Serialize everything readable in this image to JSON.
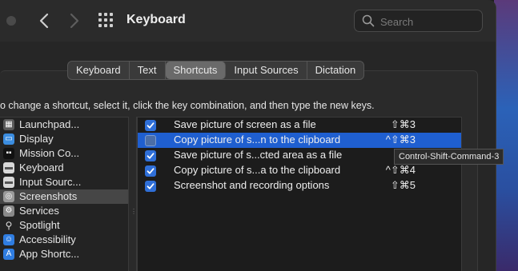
{
  "window": {
    "title": "Keyboard",
    "search": {
      "placeholder": "Search",
      "value": ""
    }
  },
  "tabs": [
    {
      "label": "Keyboard",
      "active": false
    },
    {
      "label": "Text",
      "active": false
    },
    {
      "label": "Shortcuts",
      "active": true
    },
    {
      "label": "Input Sources",
      "active": false
    },
    {
      "label": "Dictation",
      "active": false
    }
  ],
  "instruction": "o change a shortcut, select it, click the key combination, and then type the new keys.",
  "sidebar": {
    "items": [
      {
        "label": "Launchpad...",
        "icon": "launchpad-icon",
        "selected": false
      },
      {
        "label": "Display",
        "icon": "display-icon",
        "selected": false
      },
      {
        "label": "Mission Co...",
        "icon": "mission-control-icon",
        "selected": false
      },
      {
        "label": "Keyboard",
        "icon": "keyboard-icon",
        "selected": false
      },
      {
        "label": "Input Sourc...",
        "icon": "input-sources-icon",
        "selected": false
      },
      {
        "label": "Screenshots",
        "icon": "screenshot-icon",
        "selected": true
      },
      {
        "label": "Services",
        "icon": "gear-icon",
        "selected": false
      },
      {
        "label": "Spotlight",
        "icon": "spotlight-icon",
        "selected": false
      },
      {
        "label": "Accessibility",
        "icon": "accessibility-icon",
        "selected": false
      },
      {
        "label": "App Shortc...",
        "icon": "app-shortcuts-icon",
        "selected": false
      }
    ]
  },
  "shortcuts": [
    {
      "label": "Save picture of screen as a file",
      "keys": "⇧⌘3",
      "checked": true,
      "selected": false
    },
    {
      "label": "Copy picture of s...n to the clipboard",
      "keys": "^⇧⌘3",
      "checked": false,
      "selected": true
    },
    {
      "label": "Save picture of s...cted area as a file",
      "keys": "⇧",
      "checked": true,
      "selected": false
    },
    {
      "label": "Copy picture of s...a to the clipboard",
      "keys": "^⇧⌘4",
      "checked": true,
      "selected": false
    },
    {
      "label": "Screenshot and recording options",
      "keys": "⇧⌘5",
      "checked": true,
      "selected": false
    }
  ],
  "tooltip": "Control-Shift-Command-3",
  "colors": {
    "selection": "#1f5fd0",
    "checkbox": "#2f6fd8"
  }
}
